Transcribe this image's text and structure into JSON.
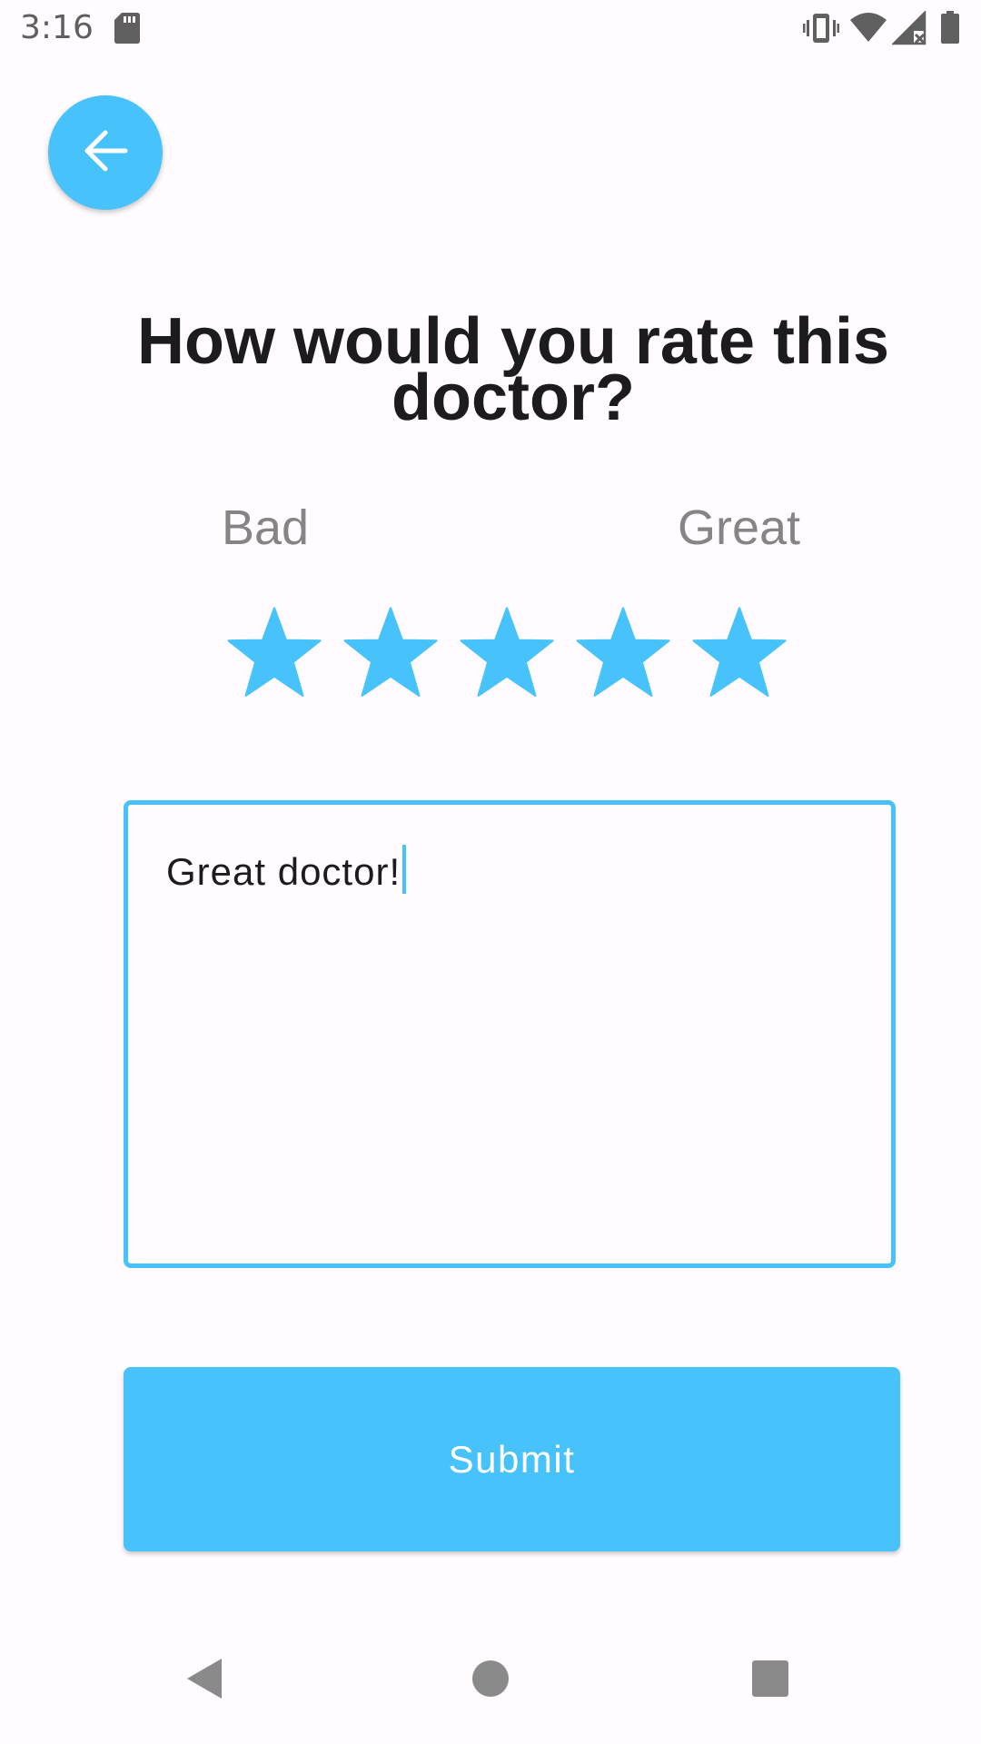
{
  "status_bar": {
    "time": "3:16",
    "icons": [
      "sd-card-icon",
      "vibrate-icon",
      "wifi-icon",
      "signal-no-data-icon",
      "battery-icon"
    ]
  },
  "back_button": {
    "icon": "arrow-left-icon"
  },
  "title": "How would you rate this doctor?",
  "rating": {
    "low_label": "Bad",
    "high_label": "Great",
    "value": 5,
    "max": 5,
    "star_icon": "star-icon"
  },
  "comment": {
    "value": "Great doctor!"
  },
  "submit": {
    "label": "Submit"
  },
  "nav_bar": {
    "icons": [
      "nav-back-icon",
      "nav-home-icon",
      "nav-recents-icon"
    ]
  },
  "colors": {
    "accent": "#47c2fb",
    "background": "#fffbfe",
    "title": "#1c1b1f",
    "label": "#858585"
  }
}
